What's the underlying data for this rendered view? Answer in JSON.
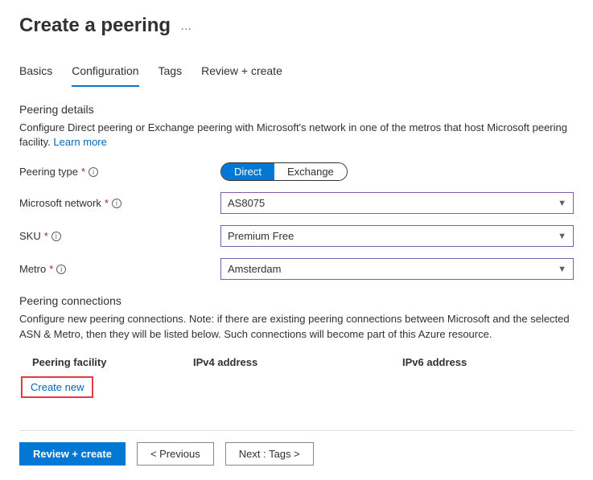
{
  "title": "Create a peering",
  "tabs": {
    "basics": "Basics",
    "configuration": "Configuration",
    "tags": "Tags",
    "review": "Review + create"
  },
  "details": {
    "heading": "Peering details",
    "desc": "Configure Direct peering or Exchange peering with Microsoft's network in one of the metros that host Microsoft peering facility. ",
    "learn_more": "Learn more"
  },
  "form": {
    "peering_type": {
      "label": "Peering type",
      "option_direct": "Direct",
      "option_exchange": "Exchange",
      "selected": "Direct"
    },
    "ms_network": {
      "label": "Microsoft network",
      "value": "AS8075"
    },
    "sku": {
      "label": "SKU",
      "value": "Premium Free"
    },
    "metro": {
      "label": "Metro",
      "value": "Amsterdam"
    }
  },
  "connections": {
    "heading": "Peering connections",
    "desc": "Configure new peering connections. Note: if there are existing peering connections between Microsoft and the selected ASN & Metro, then they will be listed below. Such connections will become part of this Azure resource.",
    "col_facility": "Peering facility",
    "col_ipv4": "IPv4 address",
    "col_ipv6": "IPv6 address",
    "create_new": "Create new"
  },
  "footer": {
    "review": "Review + create",
    "previous": "< Previous",
    "next": "Next : Tags >"
  }
}
